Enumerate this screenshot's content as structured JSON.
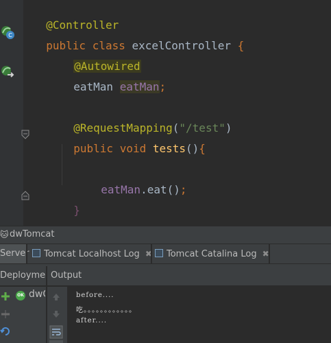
{
  "editor": {
    "lines": {
      "l1": "@Controller",
      "l2_kw": "public class",
      "l2_name": " excelController ",
      "l2_brace": "{",
      "l3": "@Autowired",
      "l4_type": "eatMan ",
      "l4_field": "eatMan",
      "l4_semi": ";",
      "l6_ann": "@RequestMapping",
      "l6_open": "(",
      "l6_str": "\"/test\"",
      "l6_close": ")",
      "l7_kw": "public void",
      "l7_name": " tests",
      "l7_paren": "()",
      "l7_brace": "{",
      "l9_field": "eatMan",
      "l9_call": ".eat",
      "l9_paren": "()",
      "l9_semi": ";",
      "l10": "}"
    },
    "gutter_icons": [
      "spring-controller-icon",
      "spring-bean-icon"
    ]
  },
  "toolwindow": {
    "title": "dwTomcat",
    "tabs": [
      {
        "label": "Server",
        "active": true
      },
      {
        "label": "Tomcat Localhost Log",
        "close": "✖"
      },
      {
        "label": "Tomcat Catalina Log",
        "close": "✖"
      }
    ],
    "deployment_header": "Deployment",
    "output_header": "Output",
    "deployment_item": "dwC",
    "status_badge": "OK",
    "output_lines": [
      "before....",
      "吃。。。。。。。。。。。。",
      "after...."
    ]
  },
  "colors": {
    "background": "#2b2b2b",
    "keyword": "#cc7832",
    "annotation": "#bbb529",
    "field": "#9876aa",
    "method": "#ffc66d",
    "string": "#6a8759"
  }
}
